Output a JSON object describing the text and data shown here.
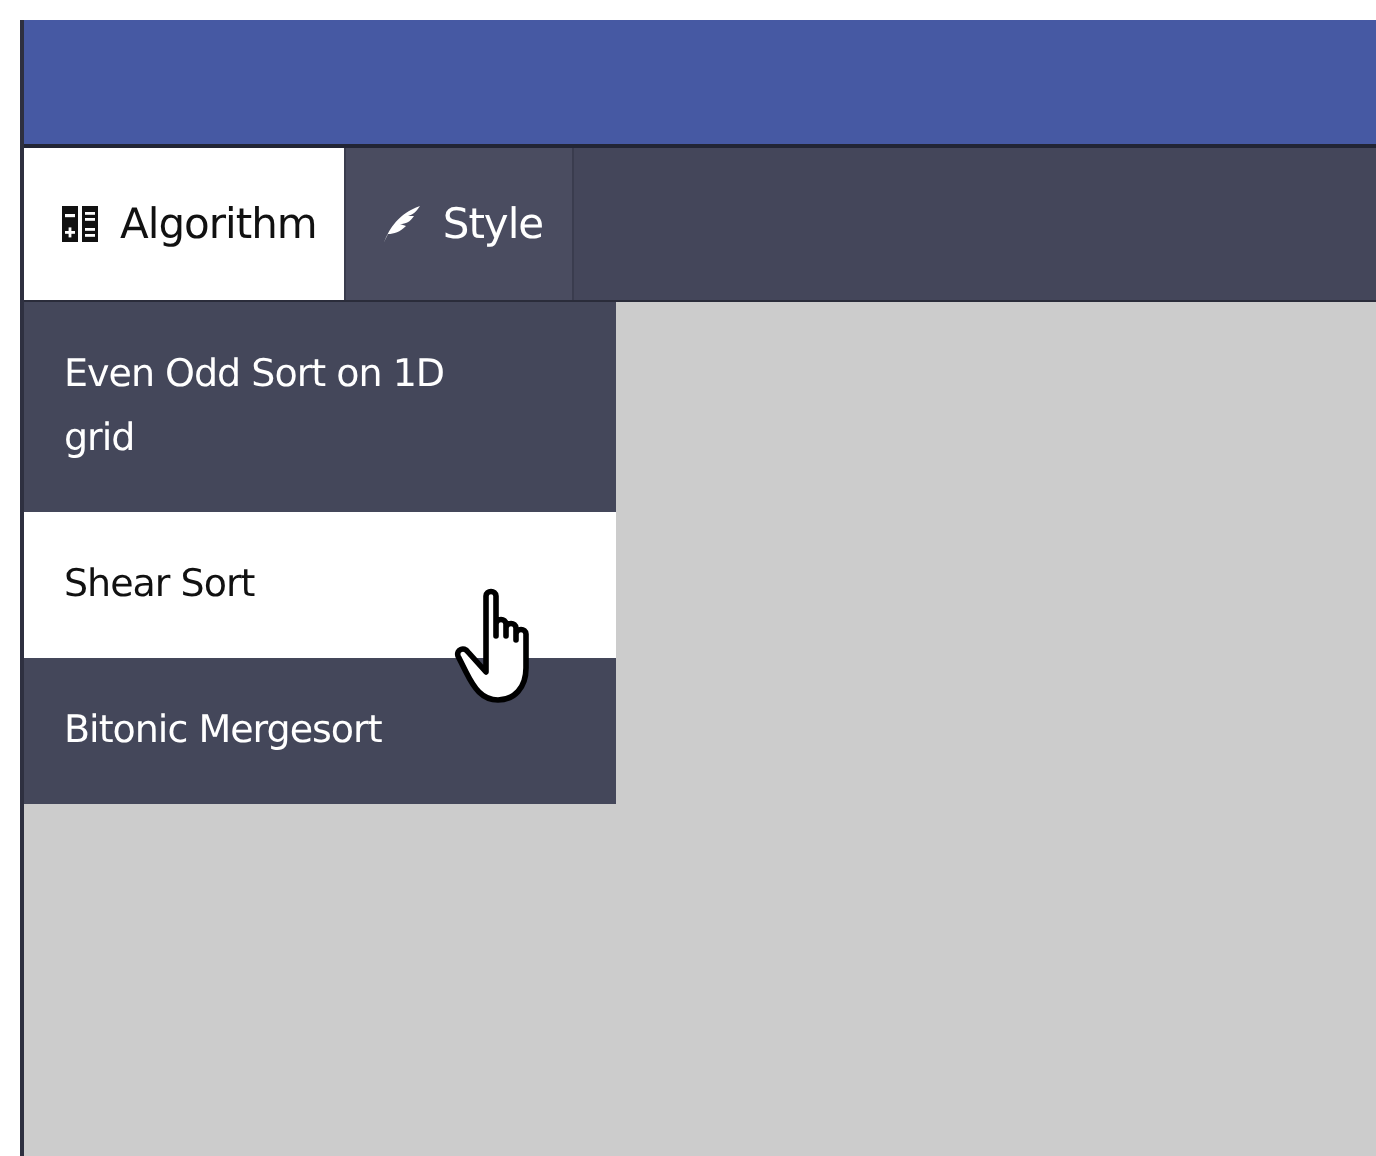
{
  "tabs": [
    {
      "label": "Algorithm",
      "kind": "calculator",
      "selected": true
    },
    {
      "label": "Style",
      "kind": "feather",
      "selected": false
    }
  ],
  "menu": {
    "items": [
      {
        "label": "Even Odd Sort on 1D grid",
        "highlighted": false,
        "pointer": false
      },
      {
        "label": "Shear Sort",
        "highlighted": true,
        "pointer": true
      },
      {
        "label": "Bitonic Mergesort",
        "highlighted": false,
        "pointer": false
      }
    ]
  }
}
